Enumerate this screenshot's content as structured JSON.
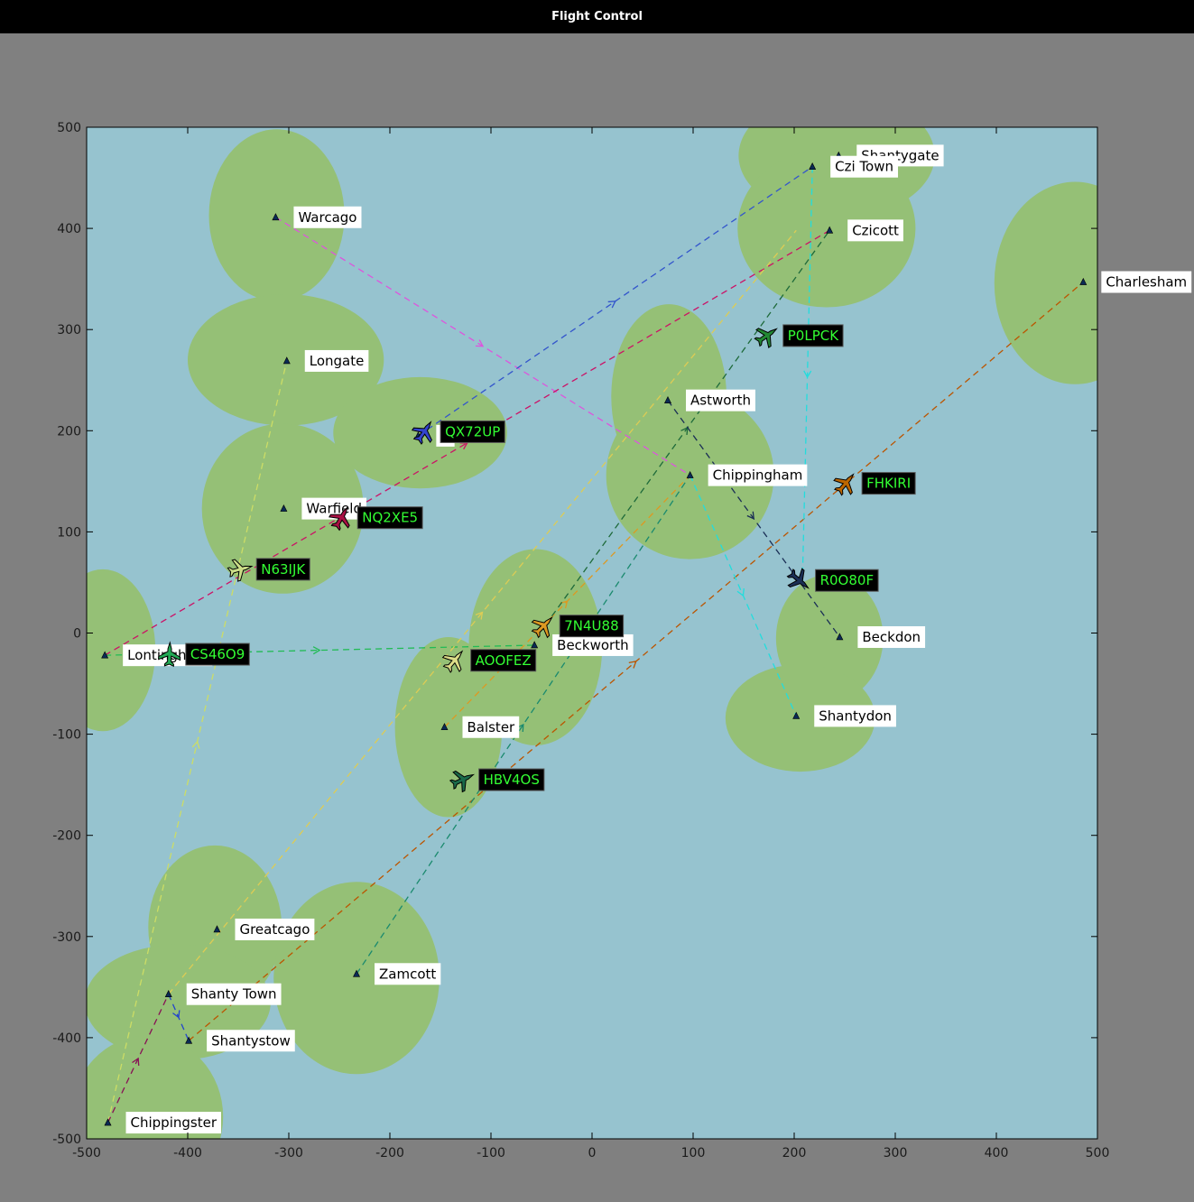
{
  "window": {
    "title": "Flight Control"
  },
  "colors": {
    "background": "#808080",
    "water": "#96c3cf",
    "land": "#95c076",
    "callsign_text": "#33ff33",
    "callsign_box": "#000000"
  },
  "axes": {
    "xlim": [
      -500,
      500
    ],
    "ylim": [
      -500,
      500
    ],
    "xticks": [
      "-500",
      "-400",
      "-300",
      "-200",
      "-100",
      "0",
      "100",
      "200",
      "300",
      "400",
      "500"
    ],
    "yticks": [
      "500",
      "400",
      "300",
      "200",
      "100",
      "0",
      "-100",
      "-200",
      "-300",
      "-400",
      "-500"
    ]
  },
  "land_masses": [
    {
      "cx": -312,
      "cy": 413,
      "rx": 67,
      "ry": 85
    },
    {
      "cx": -303,
      "cy": 270,
      "rx": 97,
      "ry": 65
    },
    {
      "cx": -170,
      "cy": 198,
      "rx": 86,
      "ry": 55
    },
    {
      "cx": -306,
      "cy": 123,
      "rx": 80,
      "ry": 84
    },
    {
      "cx": -484,
      "cy": -17,
      "rx": 52,
      "ry": 80
    },
    {
      "cx": 242,
      "cy": 472,
      "rx": 97,
      "ry": 62
    },
    {
      "cx": 232,
      "cy": 400,
      "rx": 88,
      "ry": 78
    },
    {
      "cx": 478,
      "cy": 346,
      "rx": 80,
      "ry": 100
    },
    {
      "cx": 76,
      "cy": 234,
      "rx": 57,
      "ry": 91
    },
    {
      "cx": 97,
      "cy": 156,
      "rx": 83,
      "ry": 83
    },
    {
      "cx": -56,
      "cy": -14,
      "rx": 66,
      "ry": 97
    },
    {
      "cx": -142,
      "cy": -93,
      "rx": 53,
      "ry": 89
    },
    {
      "cx": 235,
      "cy": -5,
      "rx": 53,
      "ry": 63
    },
    {
      "cx": 206,
      "cy": -84,
      "rx": 74,
      "ry": 53
    },
    {
      "cx": -373,
      "cy": -291,
      "rx": 66,
      "ry": 81
    },
    {
      "cx": -410,
      "cy": -365,
      "rx": 92,
      "ry": 57
    },
    {
      "cx": -233,
      "cy": -341,
      "rx": 82,
      "ry": 95
    },
    {
      "cx": -440,
      "cy": -478,
      "rx": 75,
      "ry": 80
    }
  ],
  "airports": [
    {
      "name": "Warcago",
      "x": -313,
      "y": 411
    },
    {
      "name": "Longate",
      "x": -302,
      "y": 269
    },
    {
      "name": "B",
      "x": -172,
      "y": 195
    },
    {
      "name": "Warfield",
      "x": -305,
      "y": 123
    },
    {
      "name": "Lontingham",
      "x": -482,
      "y": -22
    },
    {
      "name": "Shantygate",
      "x": 244,
      "y": 472
    },
    {
      "name": "Czi Town",
      "x": 218,
      "y": 461
    },
    {
      "name": "Czicott",
      "x": 235,
      "y": 398
    },
    {
      "name": "Charlesham",
      "x": 486,
      "y": 347
    },
    {
      "name": "Astworth",
      "x": 75,
      "y": 230
    },
    {
      "name": "Chippingham",
      "x": 97,
      "y": 156
    },
    {
      "name": "Beckworth",
      "x": -57,
      "y": -12
    },
    {
      "name": "Beckdon",
      "x": 245,
      "y": -4
    },
    {
      "name": "Shantydon",
      "x": 202,
      "y": -82
    },
    {
      "name": "Balster",
      "x": -146,
      "y": -93
    },
    {
      "name": "Greatcago",
      "x": -371,
      "y": -293
    },
    {
      "name": "Zamcott",
      "x": -233,
      "y": -337
    },
    {
      "name": "Shanty Town",
      "x": -419,
      "y": -357
    },
    {
      "name": "Shantystow",
      "x": -399,
      "y": -403
    },
    {
      "name": "Chippingster",
      "x": -479,
      "y": -484
    }
  ],
  "routes": [
    {
      "color": "#dd55dd",
      "x1": -313,
      "y1": 411,
      "x2": 97,
      "y2": 156
    },
    {
      "color": "#3355cc",
      "x1": -172,
      "y1": 195,
      "x2": 218,
      "y2": 461
    },
    {
      "color": "#cc1166",
      "x1": -482,
      "y1": -22,
      "x2": 235,
      "y2": 398
    },
    {
      "color": "#bb5500",
      "x1": -399,
      "y1": -403,
      "x2": 486,
      "y2": 347
    },
    {
      "color": "#1a8a6e",
      "x1": -233,
      "y1": -337,
      "x2": 97,
      "y2": 156
    },
    {
      "color": "#22bb55",
      "x1": -482,
      "y1": -22,
      "x2": -57,
      "y2": -12
    },
    {
      "color": "#ccdd66",
      "x1": -479,
      "y1": -484,
      "x2": -302,
      "y2": 269
    },
    {
      "color": "#ddcc55",
      "x1": -419,
      "y1": -357,
      "x2": 202,
      "y2": 398
    },
    {
      "color": "#dd9922",
      "x1": -146,
      "y1": -93,
      "x2": 97,
      "y2": 156
    },
    {
      "color": "#1e6a3a",
      "x1": -46,
      "y1": 8,
      "x2": 235,
      "y2": 398
    },
    {
      "color": "#22dddd",
      "x1": 218,
      "y1": 461,
      "x2": 208,
      "y2": 45
    },
    {
      "color": "#1a2e55",
      "x1": 75,
      "y1": 230,
      "x2": 245,
      "y2": -4
    },
    {
      "color": "#22dddd",
      "x1": 97,
      "y1": 156,
      "x2": 202,
      "y2": -82
    },
    {
      "color": "#2244cc",
      "x1": -419,
      "y1": -357,
      "x2": -399,
      "y2": -403
    },
    {
      "color": "#881155",
      "x1": -479,
      "y1": -484,
      "x2": -419,
      "y2": -357
    }
  ],
  "aircraft": [
    {
      "callsign": "QX72UP",
      "x": -166,
      "y": 199,
      "color": "#3344cc",
      "heading": 34
    },
    {
      "callsign": "NQ2XE5",
      "x": -248,
      "y": 114,
      "color": "#aa1144",
      "heading": 30
    },
    {
      "callsign": "N63IJK",
      "x": -348,
      "y": 63,
      "color": "#ccdd88",
      "heading": 75
    },
    {
      "callsign": "CS46O9",
      "x": -418,
      "y": -21,
      "color": "#22aa55",
      "heading": 2
    },
    {
      "callsign": "P0LPCK",
      "x": 173,
      "y": 294,
      "color": "#228833",
      "heading": 55
    },
    {
      "callsign": "FHKIRI",
      "x": 251,
      "y": 148,
      "color": "#bb6600",
      "heading": 40
    },
    {
      "callsign": "R0O80F",
      "x": 205,
      "y": 52,
      "color": "#1a2e55",
      "heading": 130
    },
    {
      "callsign": "7N4U88",
      "x": -48,
      "y": 7,
      "color": "#dd9922",
      "heading": 45
    },
    {
      "callsign": "AOOFEZ",
      "x": -136,
      "y": -27,
      "color": "#dddd88",
      "heading": 40
    },
    {
      "callsign": "HBV4OS",
      "x": -128,
      "y": -145,
      "color": "#1a6a4a",
      "heading": 65
    }
  ]
}
